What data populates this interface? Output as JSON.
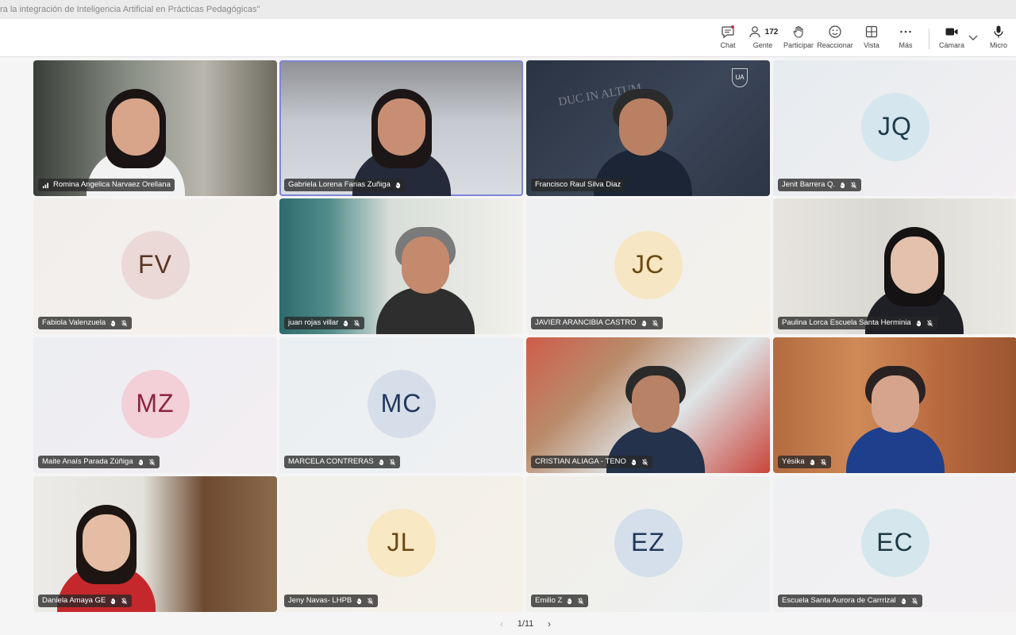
{
  "window": {
    "title": "ra la integración de Inteligencia Artificial en Prácticas Pedagógicas\""
  },
  "toolbar": {
    "chat_label": "Chat",
    "people_count": "172",
    "people_label": "Gente",
    "raise_label": "Participar",
    "react_label": "Reaccionar",
    "view_label": "Vista",
    "more_label": "Más",
    "camera_label": "Cámara",
    "mic_label": "Micro"
  },
  "participants": [
    {
      "name": "Romina Angelica Narvaez Orellana",
      "initials": ""
    },
    {
      "name": "Gabriela Lorena Farias Zuñiga",
      "initials": ""
    },
    {
      "name": "Francisco Raul Silva Diaz",
      "initials": "",
      "bg_text": "DUC IN ALTUM",
      "logo_text": "UA"
    },
    {
      "name": "Jenit Barrera Q.",
      "initials": "JQ"
    },
    {
      "name": "Fabiola Valenzuela",
      "initials": "FV"
    },
    {
      "name": "juan rojas villar",
      "initials": ""
    },
    {
      "name": "JAVIER ARANCIBIA CASTRO",
      "initials": "JC"
    },
    {
      "name": "Paulina Lorca Escuela Santa Herminia",
      "initials": ""
    },
    {
      "name": "Maite Anaís Parada Zúñiga",
      "initials": "MZ"
    },
    {
      "name": "MARCELA CONTRERAS",
      "initials": "MC"
    },
    {
      "name": "CRISTIAN ALIAGA - TENO",
      "initials": ""
    },
    {
      "name": "Yésika",
      "initials": ""
    },
    {
      "name": "Daniela Amaya GE",
      "initials": ""
    },
    {
      "name": "Jeny Navas- LHPB",
      "initials": "JL"
    },
    {
      "name": "Emilio Z",
      "initials": "EZ"
    },
    {
      "name": "Escuela Santa Aurora de Carrrizal",
      "initials": "EC"
    }
  ],
  "pagination": {
    "label": "1/11"
  },
  "colors": {
    "accent": "#7f85d6",
    "bar": "#ffffff"
  }
}
